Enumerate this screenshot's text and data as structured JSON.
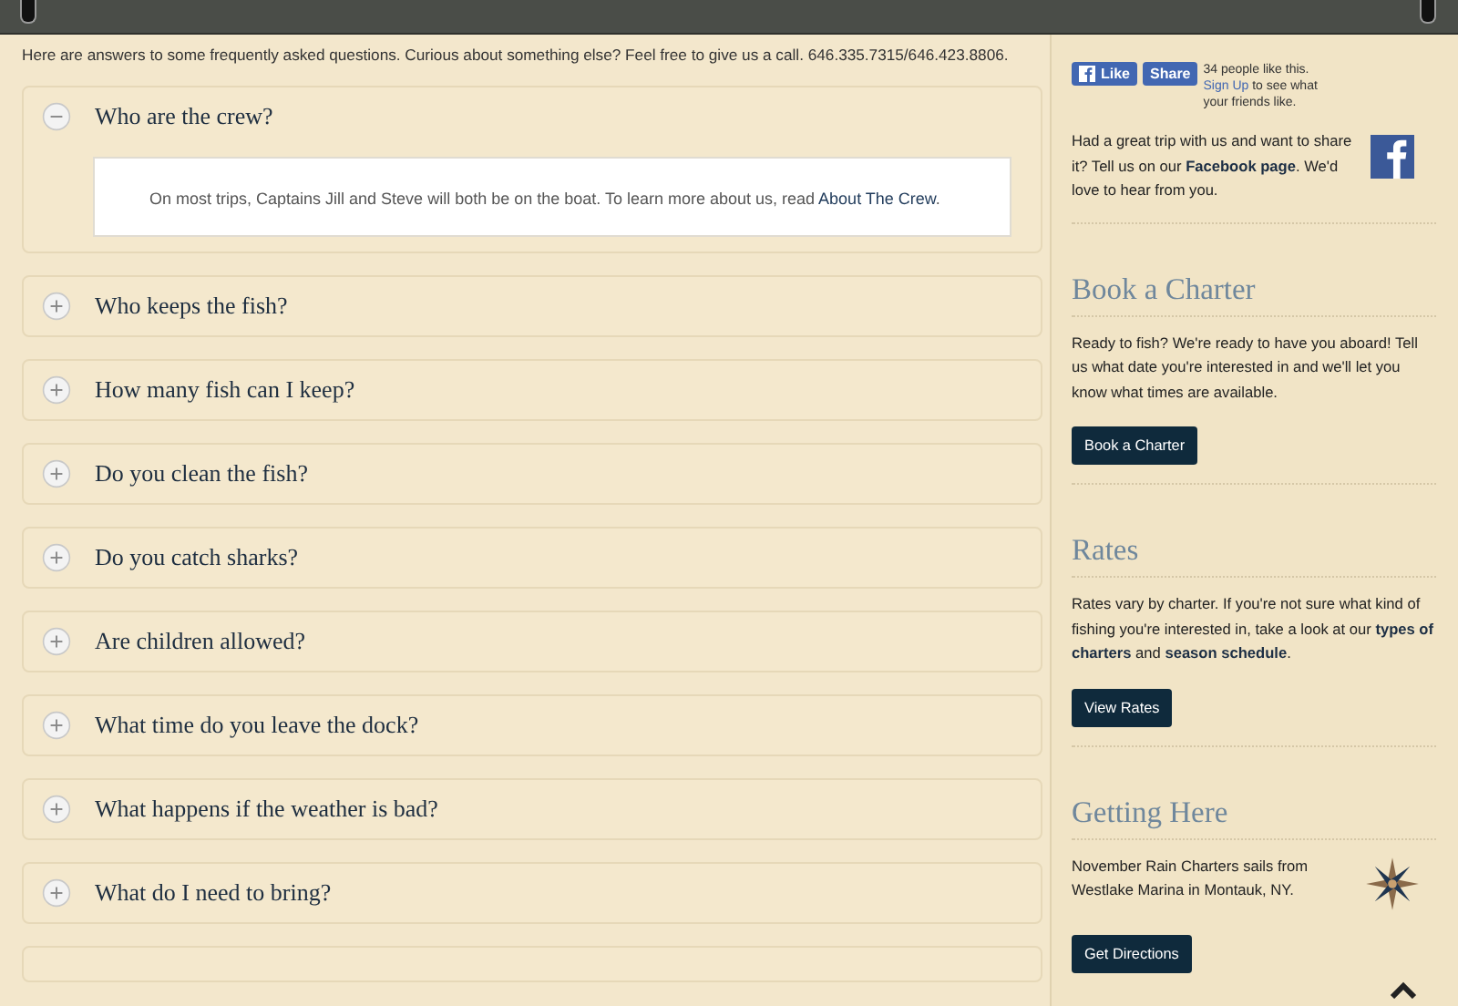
{
  "intro": "Here are answers to some frequently asked questions. Curious about something else? Feel free to give us a call. 646.335.7315/646.423.8806.",
  "faq": [
    {
      "question": "Who are the crew?",
      "expanded": true,
      "answer": {
        "before": "On most trips, Captains Jill and Steve will both be on the boat. To learn more about us, read",
        "link": "About The Crew",
        "after": "."
      }
    },
    {
      "question": "Who keeps the fish?",
      "expanded": false
    },
    {
      "question": "How many fish can I keep?",
      "expanded": false
    },
    {
      "question": "Do you clean the fish?",
      "expanded": false
    },
    {
      "question": "Do you catch sharks?",
      "expanded": false
    },
    {
      "question": "Are children allowed?",
      "expanded": false
    },
    {
      "question": "What time do you leave the dock?",
      "expanded": false
    },
    {
      "question": "What happens if the weather is bad?",
      "expanded": false
    },
    {
      "question": "What do I need to bring?",
      "expanded": false
    }
  ],
  "sidebar": {
    "facebook": {
      "like": "Like",
      "share": "Share",
      "count_text": "34 people like this.",
      "signup_link": "Sign Up",
      "signup_rest": "to see what your friends like.",
      "text": "Had a great trip with us and want to share it? Tell us on our **Facebook page**. We'd love to hear from you."
    },
    "sections": [
      {
        "kind": "plain",
        "heading": "Book a Charter",
        "text": "Ready to fish? We're ready to have you aboard! Tell us what date you're interested in and we'll let you know what times are available.",
        "button": "Book a Charter"
      },
      {
        "kind": "plain",
        "heading": "Rates",
        "text": "Rates vary by charter. If you're not sure what kind of fishing you're interested in, take a look at our **types of charters** and **season schedule**.",
        "button": "View Rates"
      },
      {
        "kind": "location",
        "heading": "Getting Here",
        "text": "November Rain Charters sails from Westlake Marina in Montauk, NY.",
        "button": "Get Directions"
      }
    ]
  }
}
